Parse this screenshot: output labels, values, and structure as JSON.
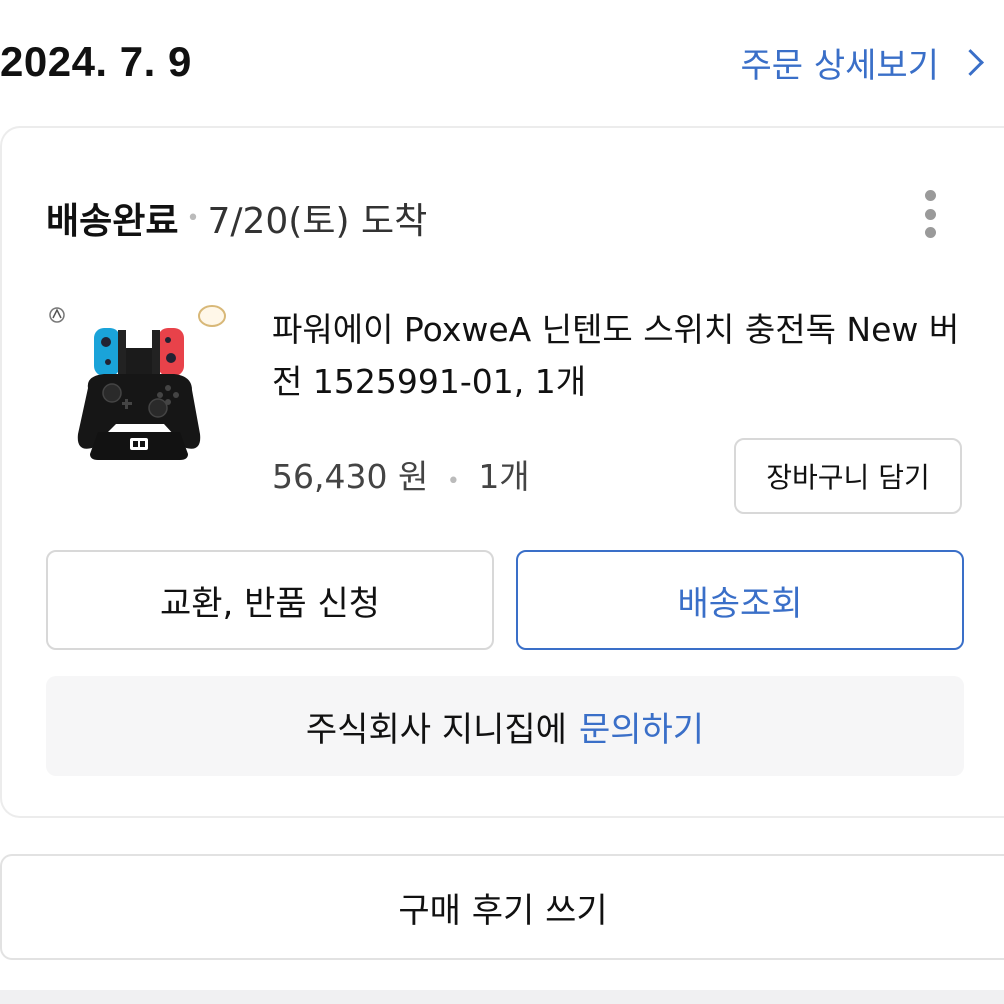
{
  "order": {
    "date": "2024. 7. 9",
    "detail_link": "주문 상세보기"
  },
  "card": {
    "status": "배송완료",
    "arrival": "7/20(토) 도착",
    "product": {
      "title": "파워에이 PoxweA 닌텐도 스위치 충전독 New 버전 1525991-01, 1개",
      "price": "56,430 원",
      "quantity": "1개"
    },
    "cart_button": "장바구니 담기",
    "exchange_button": "교환, 반품 신청",
    "tracking_button": "배송조회",
    "inquiry_prefix": "주식회사 지니집에",
    "inquiry_link": "문의하기"
  },
  "review_button": "구매 후기 쓰기",
  "colors": {
    "accent_blue": "#3a6fc8",
    "joycon_blue": "#1aa3d9",
    "joycon_red": "#e8424a"
  }
}
